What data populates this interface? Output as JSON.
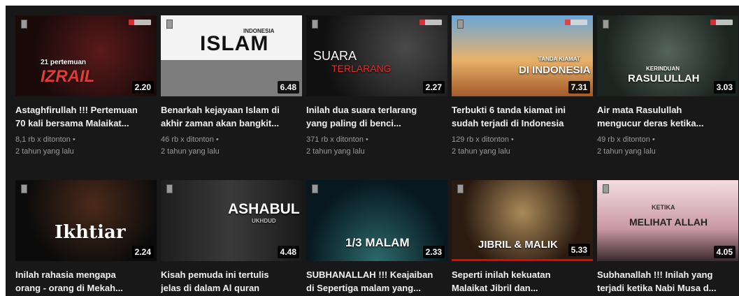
{
  "videos": [
    {
      "title_l1": "Astaghfirullah !!! Pertemuan",
      "title_l2": "70 kali bersama Malaikat...",
      "views": "8,1 rb x ditonton •",
      "age": "2 tahun yang lalu",
      "duration": "2.20",
      "thumb_text": "IZRAIL",
      "thumb_sub": "21 pertemuan",
      "bg": "#3a1414"
    },
    {
      "title_l1": "Benarkah kejayaan Islam di",
      "title_l2": "akhir zaman akan bangkit...",
      "views": "46 rb x ditonton •",
      "age": "2 tahun yang lalu",
      "duration": "6.48",
      "thumb_text": "ISLAM",
      "thumb_sub": "INDONESIA",
      "bg": "#e8e8e8"
    },
    {
      "title_l1": "Inilah dua suara terlarang",
      "title_l2": "yang paling di benci...",
      "views": "371 rb x ditonton •",
      "age": "2 tahun yang lalu",
      "duration": "2.27",
      "thumb_text": "SUARA",
      "thumb_sub": "TERLARANG",
      "bg": "#2a2a2a"
    },
    {
      "title_l1": "Terbukti 6 tanda kiamat ini",
      "title_l2": "sudah terjadi di Indonesia",
      "views": "129 rb x ditonton •",
      "age": "2 tahun yang lalu",
      "duration": "7.31",
      "thumb_text": "DI INDONESIA",
      "thumb_sub": "TANDA KIAMAT",
      "bg": "#c97a3a"
    },
    {
      "title_l1": "Air mata Rasulullah",
      "title_l2": "mengucur deras ketika...",
      "views": "49 rb x ditonton •",
      "age": "2 tahun yang lalu",
      "duration": "3.03",
      "thumb_text": "RASULULLAH",
      "thumb_sub": "KERINDUAN",
      "bg": "#3c4a44"
    },
    {
      "title_l1": "Inilah rahasia mengapa",
      "title_l2": "orang - orang di Mekah...",
      "duration": "2.24",
      "thumb_text": "Ikhtiar",
      "thumb_sub": "",
      "bg": "#141414"
    },
    {
      "title_l1": "Kisah pemuda ini tertulis",
      "title_l2": "jelas di dalam Al quran",
      "duration": "4.48",
      "thumb_text": "ASHABUL",
      "thumb_sub": "UKHDUD",
      "bg": "#2b2b2b"
    },
    {
      "title_l1": "SUBHANALLAH !!! Keajaiban",
      "title_l2": "di Sepertiga malam yang...",
      "duration": "2.33",
      "thumb_text": "1/3 MALAM",
      "thumb_sub": "",
      "bg": "#0f2a30"
    },
    {
      "title_l1": "Seperti inilah kekuatan",
      "title_l2": "Malaikat Jibril dan...",
      "duration": "5.33",
      "thumb_text": "JIBRIL & MALIK",
      "thumb_sub": "",
      "bg": "#3a2a1e"
    },
    {
      "title_l1": "Subhanallah !!! Inilah yang",
      "title_l2": "terjadi ketika Nabi Musa d...",
      "duration": "4.05",
      "thumb_text": "MELIHAT ALLAH",
      "thumb_sub": "KETIKA",
      "bg": "#e9c7cf"
    }
  ],
  "colors": {
    "background": "#181818",
    "title": "#f1f1f1",
    "meta": "#9a9a9a",
    "progress": "#ee0000"
  }
}
